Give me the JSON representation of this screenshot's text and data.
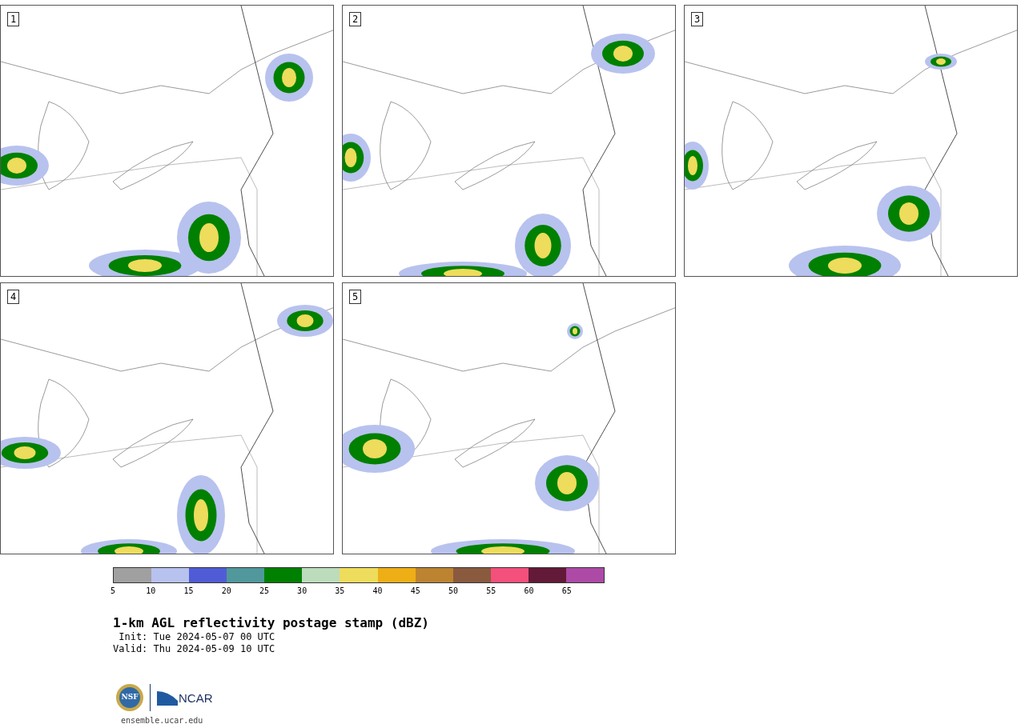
{
  "panels": [
    {
      "label": "1"
    },
    {
      "label": "2"
    },
    {
      "label": "3"
    },
    {
      "label": "4"
    },
    {
      "label": "5"
    }
  ],
  "colorbar": {
    "segments": [
      {
        "color": "#a0a0a0"
      },
      {
        "color": "#b8c2ee"
      },
      {
        "color": "#505cd6"
      },
      {
        "color": "#50989c"
      },
      {
        "color": "#008000"
      },
      {
        "color": "#bcdcbc"
      },
      {
        "color": "#eedc5c"
      },
      {
        "color": "#eeae16"
      },
      {
        "color": "#bc8430"
      },
      {
        "color": "#8a5a3e"
      },
      {
        "color": "#f4507c"
      },
      {
        "color": "#621a38"
      },
      {
        "color": "#ac4aa6"
      }
    ],
    "ticks": [
      "5",
      "10",
      "15",
      "20",
      "25",
      "30",
      "35",
      "40",
      "45",
      "50",
      "55",
      "60",
      "65"
    ]
  },
  "title": "1-km AGL reflectivity postage stamp (dBZ)",
  "init": " Init: Tue 2024-05-07 00 UTC",
  "valid": "Valid: Thu 2024-05-09 10 UTC",
  "logo": {
    "seal": "NSF",
    "wordmark": "NCAR"
  },
  "site": "ensemble.ucar.edu"
}
